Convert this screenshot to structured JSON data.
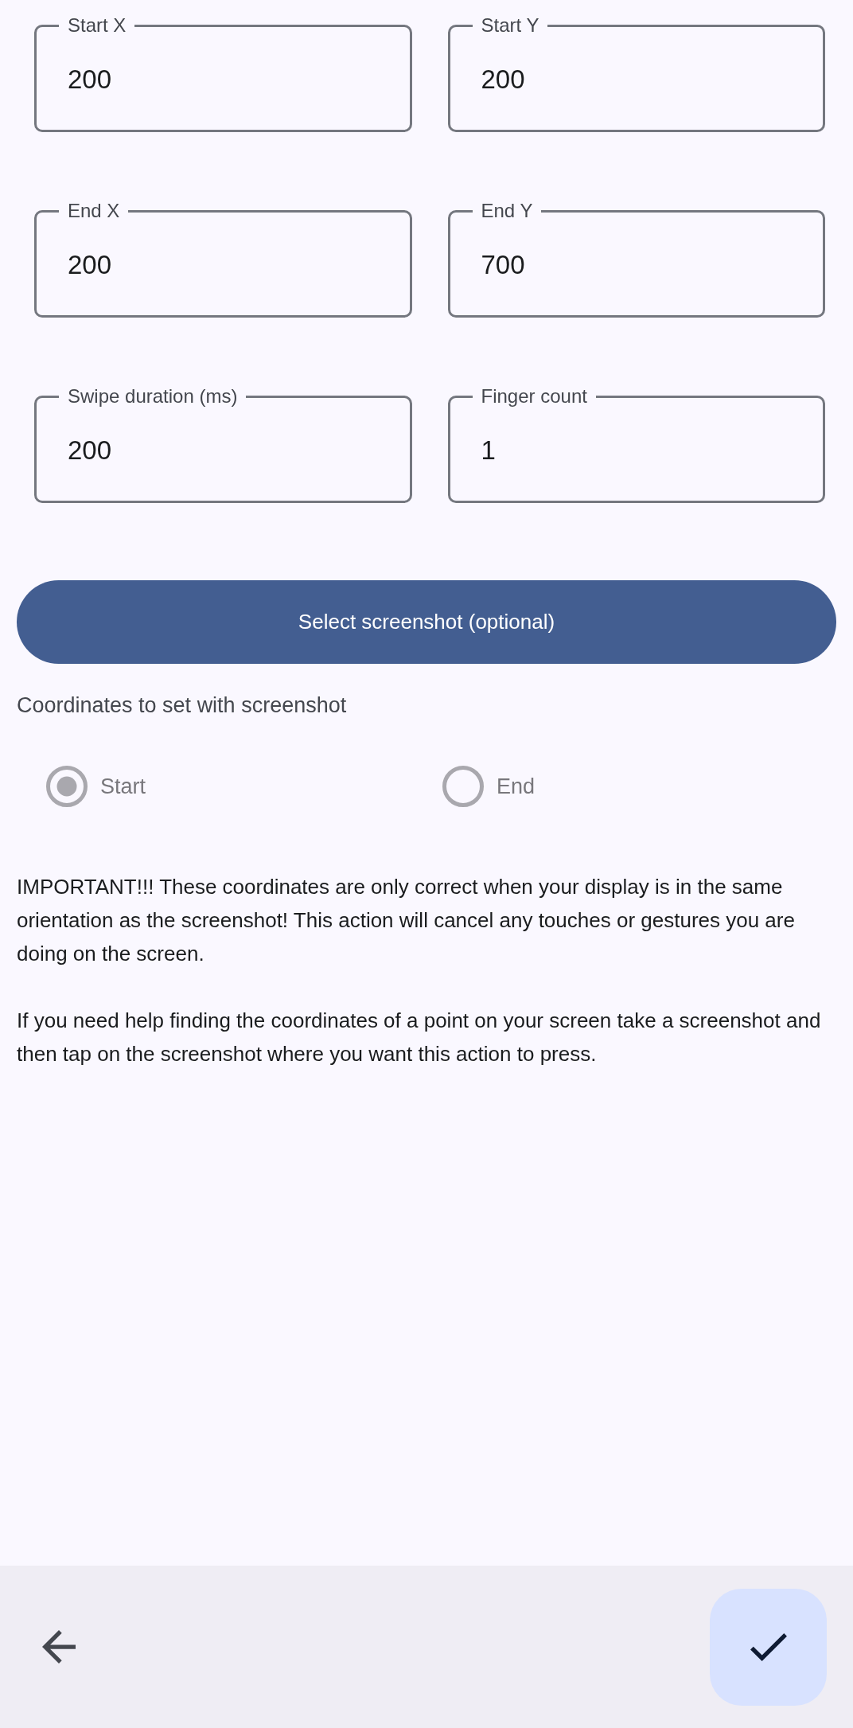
{
  "fields": [
    {
      "label": "Start X",
      "value": "200"
    },
    {
      "label": "Start Y",
      "value": "200"
    },
    {
      "label": "End X",
      "value": "200"
    },
    {
      "label": "End Y",
      "value": "700"
    },
    {
      "label": "Swipe duration (ms)",
      "value": "200"
    },
    {
      "label": "Finger count",
      "value": "1"
    }
  ],
  "select_screenshot_button": {
    "label": "Select screenshot (optional)"
  },
  "coordinates_radio": {
    "label": "Coordinates to set with screenshot",
    "options": [
      {
        "label": "Start",
        "selected": true,
        "disabled": true
      },
      {
        "label": "End",
        "selected": false,
        "disabled": true
      }
    ]
  },
  "notes": [
    "IMPORTANT!!! These coordinates are only correct when your display is in the same orientation as the screenshot! This action will cancel any touches or gestures you are doing on the screen.",
    "If you need help finding the coordinates of a point on your screen take a screenshot and then tap on the screenshot where you want this action to press."
  ]
}
